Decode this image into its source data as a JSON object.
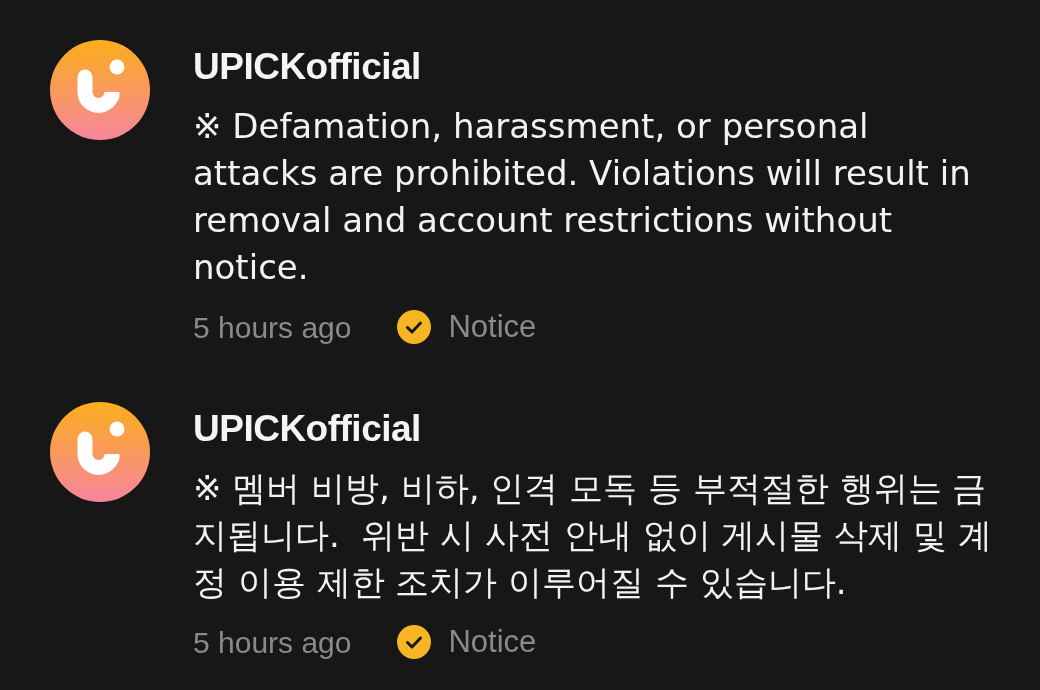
{
  "comments": [
    {
      "author": "UPICKofficial",
      "text": "※ Defamation, harassment, or personal attacks are prohibited. Violations will result in removal and account restrictions without notice.",
      "time": "5 hours ago",
      "badge": "Notice"
    },
    {
      "author": "UPICKofficial",
      "text": "※ 멤버 비방, 비하, 인격 모독 등 부적절한 행위는 금지됩니다.  위반 시 사전 안내 없이 게시물 삭제 및 계정 이용 제한 조치가 이루어질 수 있습니다.",
      "time": "5 hours ago",
      "badge": "Notice"
    }
  ]
}
